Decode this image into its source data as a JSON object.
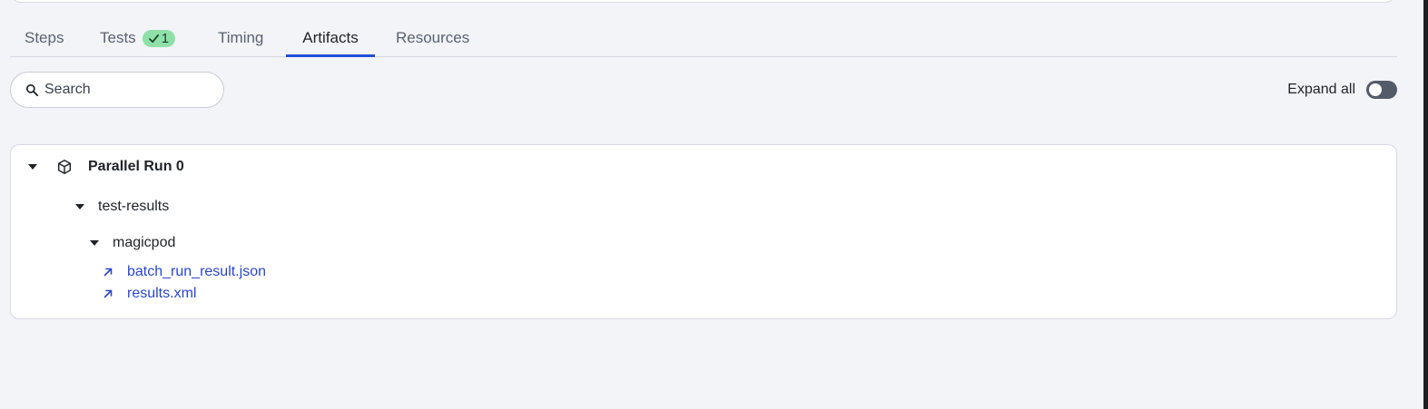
{
  "tabs": [
    {
      "label": "Steps",
      "active": false
    },
    {
      "label": "Tests",
      "active": false,
      "badge": "1"
    },
    {
      "label": "Timing",
      "active": false
    },
    {
      "label": "Artifacts",
      "active": true
    },
    {
      "label": "Resources",
      "active": false
    }
  ],
  "search": {
    "placeholder": "Search",
    "value": ""
  },
  "expand_all": {
    "label": "Expand all",
    "enabled": false
  },
  "tree": {
    "run_title": "Parallel Run 0",
    "folder": "test-results",
    "subfolder": "magicpod",
    "files": [
      "batch_run_result.json",
      "results.xml"
    ]
  },
  "colors": {
    "background": "#f3f4f8",
    "accent": "#2450d8",
    "link": "#2a47c9",
    "badge_bg": "#8fe0a8",
    "toggle_off": "#545b68"
  }
}
